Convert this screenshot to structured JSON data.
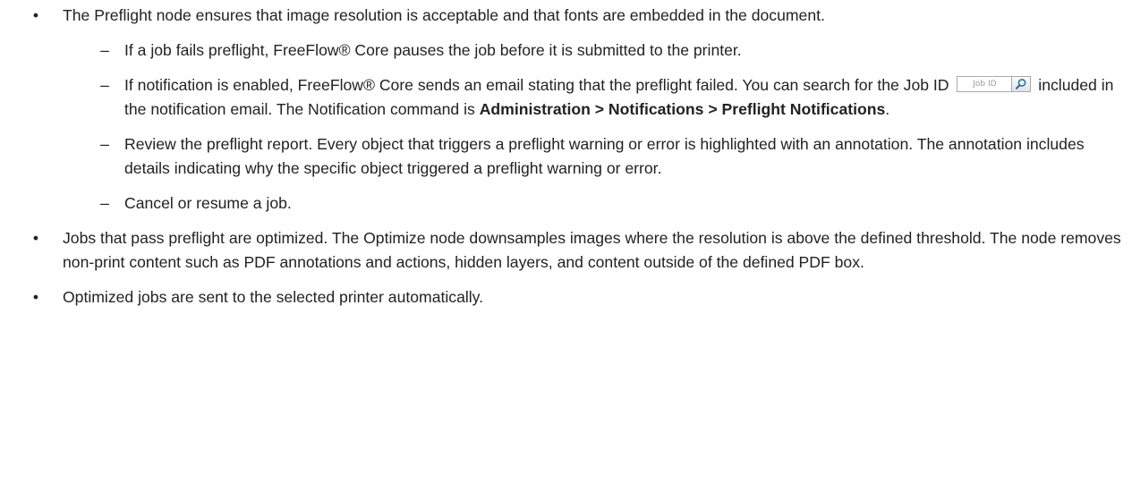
{
  "bullets": [
    {
      "text": "The Preflight node ensures that image resolution is acceptable and that fonts are embedded in the document."
    },
    {
      "text": "Jobs that pass preflight are optimized. The Optimize node downsamples images where the resolution is above the defined threshold. The node removes non-print content such as PDF annotations and actions, hidden layers, and content outside of the defined PDF box."
    },
    {
      "text": "Optimized jobs are sent to the selected printer automatically."
    }
  ],
  "sub_items": {
    "item1": "If a job fails preflight, FreeFlow® Core pauses the job before it is submitted to the printer.",
    "item2_before": "If notification is enabled, FreeFlow® Core sends an email stating that the preflight failed. You can search for the Job ID",
    "item2_after": "included in the notification email. The Notification command is",
    "item2_cmd": "Administration > Notifications > Preflight Notifications",
    "item2_end": ".",
    "item3": "Review the preflight report. Every object that triggers a preflight warning or error is highlighted with an annotation. The annotation includes details indicating why the specific object triggered a preflight warning or error.",
    "item4": "Cancel or resume a job."
  },
  "job_id_field": {
    "placeholder": "Job ID",
    "icon": "magnifier-icon"
  },
  "glyphs": {
    "bullet": "•",
    "dash": "–"
  }
}
